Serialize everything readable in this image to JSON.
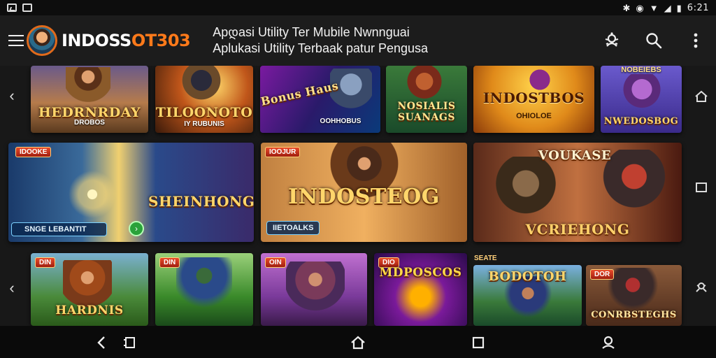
{
  "statusbar": {
    "time": "6:21",
    "left_icons": [
      "image-icon",
      "screen-record-icon"
    ],
    "right_icons": [
      "bluetooth-icon",
      "nfc-icon",
      "wifi-icon",
      "signal-icon",
      "battery-icon"
    ]
  },
  "appbar": {
    "brand_part1": "INDOSS",
    "brand_part2": "OT303",
    "title_line1": "Apდasi Utility Ter Mubile Nwnnguai",
    "title_line2": "Aplukasi Utility Terbaak patur Pengusa",
    "actions": [
      "bug-icon",
      "search-icon",
      "more-vert-icon"
    ]
  },
  "colors": {
    "accent": "#ff7a1a",
    "statusbar": "#0d0d0d",
    "appbar": "#1c1c1c",
    "navbar": "#0a0a0a"
  },
  "rows": [
    {
      "cards": [
        {
          "title": "HEDRNRDAY",
          "subtitle": "DROBOS"
        },
        {
          "title": "TILOONOTO",
          "subtitle": "IY RUBUNIS"
        },
        {
          "title": "Bonus Haus",
          "subtitle": "OOHHOBUS"
        },
        {
          "title": "NOSIALIS SUANAGS",
          "subtitle": ""
        },
        {
          "title": "INDOSTBOS",
          "subtitle": "OHIOLOE"
        },
        {
          "title": "NWEDOSBOG",
          "subtitle": "NOBEIEBS"
        }
      ]
    },
    {
      "cards": [
        {
          "badge": "IDOOKE",
          "pill": "SNGE LEBANTIT",
          "title": "SHEINHONG",
          "subtitle": ""
        },
        {
          "badge": "IOOJUR",
          "pill": "IIETOALKS",
          "title": "INDOSTEOG",
          "subtitle": ""
        },
        {
          "badge": "",
          "pill": "",
          "title": "VOUKASE",
          "subtitle": "VCRIEHONG"
        }
      ]
    },
    {
      "cards": [
        {
          "badge": "DIN",
          "title": "HARDNIS"
        },
        {
          "badge": "DIN",
          "title": ""
        },
        {
          "badge": "OIN",
          "title": ""
        },
        {
          "badge": "DIO",
          "title": "MDPOSCOS"
        },
        {
          "badge": "SEATE",
          "title": "BODOTOH"
        },
        {
          "badge": "DOR",
          "title": "CONRBSTEGHS"
        }
      ]
    }
  ]
}
